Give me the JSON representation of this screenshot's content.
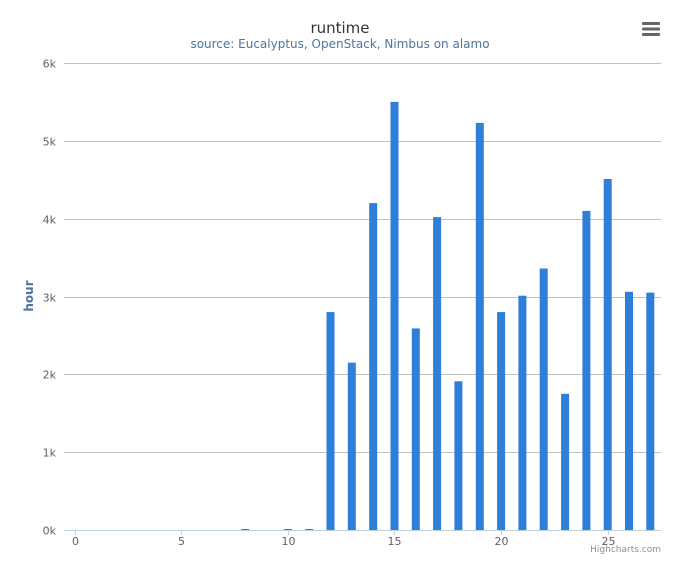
{
  "chart_data": {
    "type": "bar",
    "title": "runtime",
    "subtitle": "source: Eucalyptus, OpenStack, Nimbus on alamo",
    "xlabel": "",
    "ylabel": "hour",
    "x": [
      0,
      1,
      2,
      3,
      4,
      5,
      6,
      7,
      8,
      9,
      10,
      11,
      12,
      13,
      14,
      15,
      16,
      17,
      18,
      19,
      20,
      21,
      22,
      23,
      24,
      25,
      26,
      27
    ],
    "values": [
      0,
      0,
      0,
      0,
      0,
      0,
      0,
      0,
      10,
      0,
      10,
      10,
      2800,
      2150,
      4200,
      5500,
      2590,
      4020,
      1910,
      5230,
      2800,
      3010,
      3360,
      1750,
      4100,
      4510,
      3060,
      3050
    ],
    "xlim": [
      -0.5,
      27.5
    ],
    "ylim": [
      0,
      6000
    ],
    "x_ticks": [
      "0",
      "5",
      "10",
      "15",
      "20",
      "25"
    ],
    "x_tick_values": [
      0,
      5,
      10,
      15,
      20,
      25
    ],
    "y_ticks": [
      "0k",
      "1k",
      "2k",
      "3k",
      "4k",
      "5k",
      "6k"
    ],
    "y_tick_values": [
      0,
      1000,
      2000,
      3000,
      4000,
      5000,
      6000
    ],
    "grid": true,
    "legend": "none",
    "color": "#2f7ed8"
  },
  "credits": "Highcharts.com",
  "menu_icon": "hamburger-menu-icon"
}
